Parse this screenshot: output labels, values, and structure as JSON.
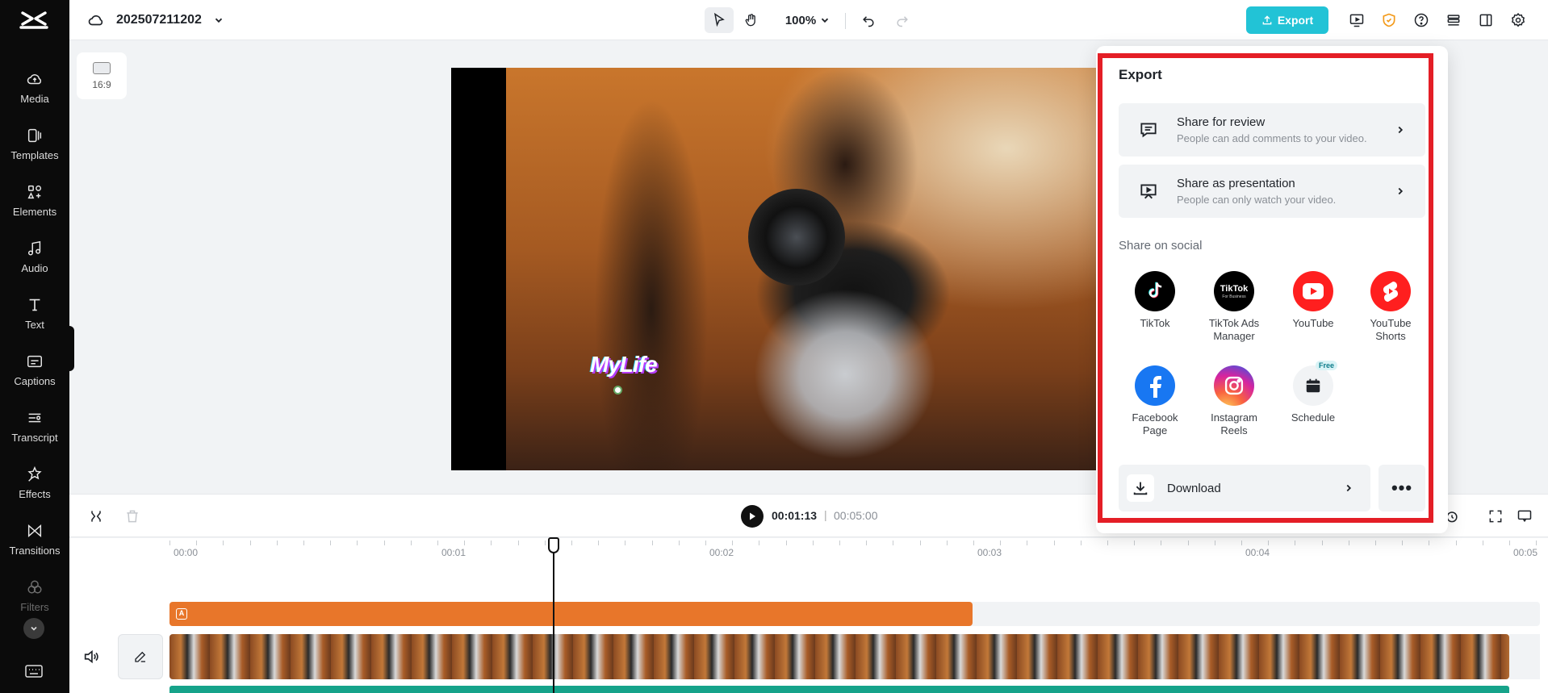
{
  "app": {
    "project_name": "202507211202",
    "zoom": "100%",
    "export_label": "Export",
    "brand_color": "#22c3d6"
  },
  "sidebar": {
    "items": [
      {
        "label": "Media",
        "icon": "cloud-upload-icon"
      },
      {
        "label": "Templates",
        "icon": "templates-icon"
      },
      {
        "label": "Elements",
        "icon": "elements-icon"
      },
      {
        "label": "Audio",
        "icon": "music-note-icon"
      },
      {
        "label": "Text",
        "icon": "text-icon"
      },
      {
        "label": "Captions",
        "icon": "captions-icon"
      },
      {
        "label": "Transcript",
        "icon": "transcript-icon"
      },
      {
        "label": "Effects",
        "icon": "effects-icon"
      },
      {
        "label": "Transitions",
        "icon": "transitions-icon"
      },
      {
        "label": "Filters",
        "icon": "filters-icon"
      }
    ]
  },
  "canvas": {
    "aspect_ratio": "16:9",
    "overlay_text": "MyLife"
  },
  "player": {
    "current_time": "00:01:13",
    "separator": "|",
    "total_time": "00:05:00"
  },
  "timeline": {
    "ruler": [
      "00:00",
      "00:01",
      "00:02",
      "00:03",
      "00:04",
      "00:05"
    ]
  },
  "export_panel": {
    "title": "Export",
    "share_review": {
      "title": "Share for review",
      "subtitle": "People can add comments to your video."
    },
    "share_presentation": {
      "title": "Share as presentation",
      "subtitle": "People can only watch your video."
    },
    "social_label": "Share on social",
    "socials": [
      {
        "label": "TikTok",
        "icon": "tiktok-icon"
      },
      {
        "label": "TikTok Ads Manager",
        "icon": "tiktok-ads-icon",
        "logo_text": "TikTok",
        "logo_sub": "For Business"
      },
      {
        "label": "YouTube",
        "icon": "youtube-icon"
      },
      {
        "label": "YouTube Shorts",
        "icon": "youtube-shorts-icon"
      },
      {
        "label": "Facebook Page",
        "icon": "facebook-icon"
      },
      {
        "label": "Instagram Reels",
        "icon": "instagram-icon"
      },
      {
        "label": "Schedule",
        "icon": "calendar-icon",
        "badge": "Free"
      }
    ],
    "download_label": "Download",
    "more_label": "•••",
    "highlight_color": "#e41e26"
  }
}
